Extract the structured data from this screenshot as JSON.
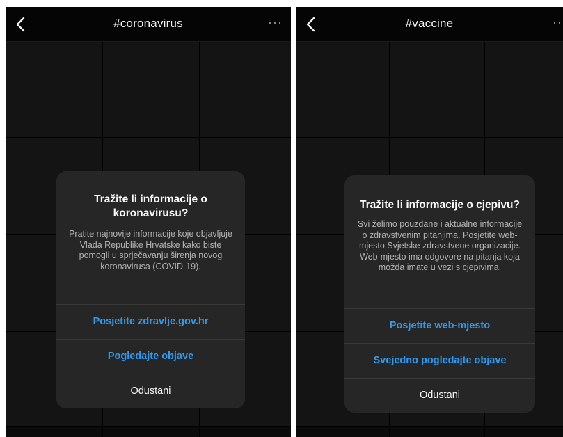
{
  "screens": [
    {
      "title": "#coronavirus",
      "more": "···",
      "dialog": {
        "heading": "Tražite li informacije o koronavirusu?",
        "message": "Pratite najnovije informacije koje objavljuje Vlada Republike Hrvatske kako biste pomogli u sprječavanju širenja novog koronavirusa (COVID-19).",
        "actions": [
          "Posjetite zdravlje.gov.hr",
          "Pogledajte objave",
          "Odustani"
        ]
      }
    },
    {
      "title": "#vaccine",
      "more": "···",
      "dialog": {
        "heading": "Tražite li informacije o cjepivu?",
        "message": "Svi želimo pouzdane i aktualne informacije o zdravstvenim pitanjima. Posjetite web-mjesto Svjetske zdravstvene organizacije. Web-mjesto ima odgovore na pitanja koja možda imate u vezi s cjepivima.",
        "actions": [
          "Posjetite web-mjesto",
          "Svejedno pogledajte objave",
          "Odustani"
        ]
      }
    }
  ],
  "colors": {
    "accent": "#2e9bf0",
    "dialog_bg": "#262626",
    "background": "#0b0b0b"
  },
  "icons": {
    "back": "chevron-left-icon",
    "more": "more-horizontal-icon"
  }
}
